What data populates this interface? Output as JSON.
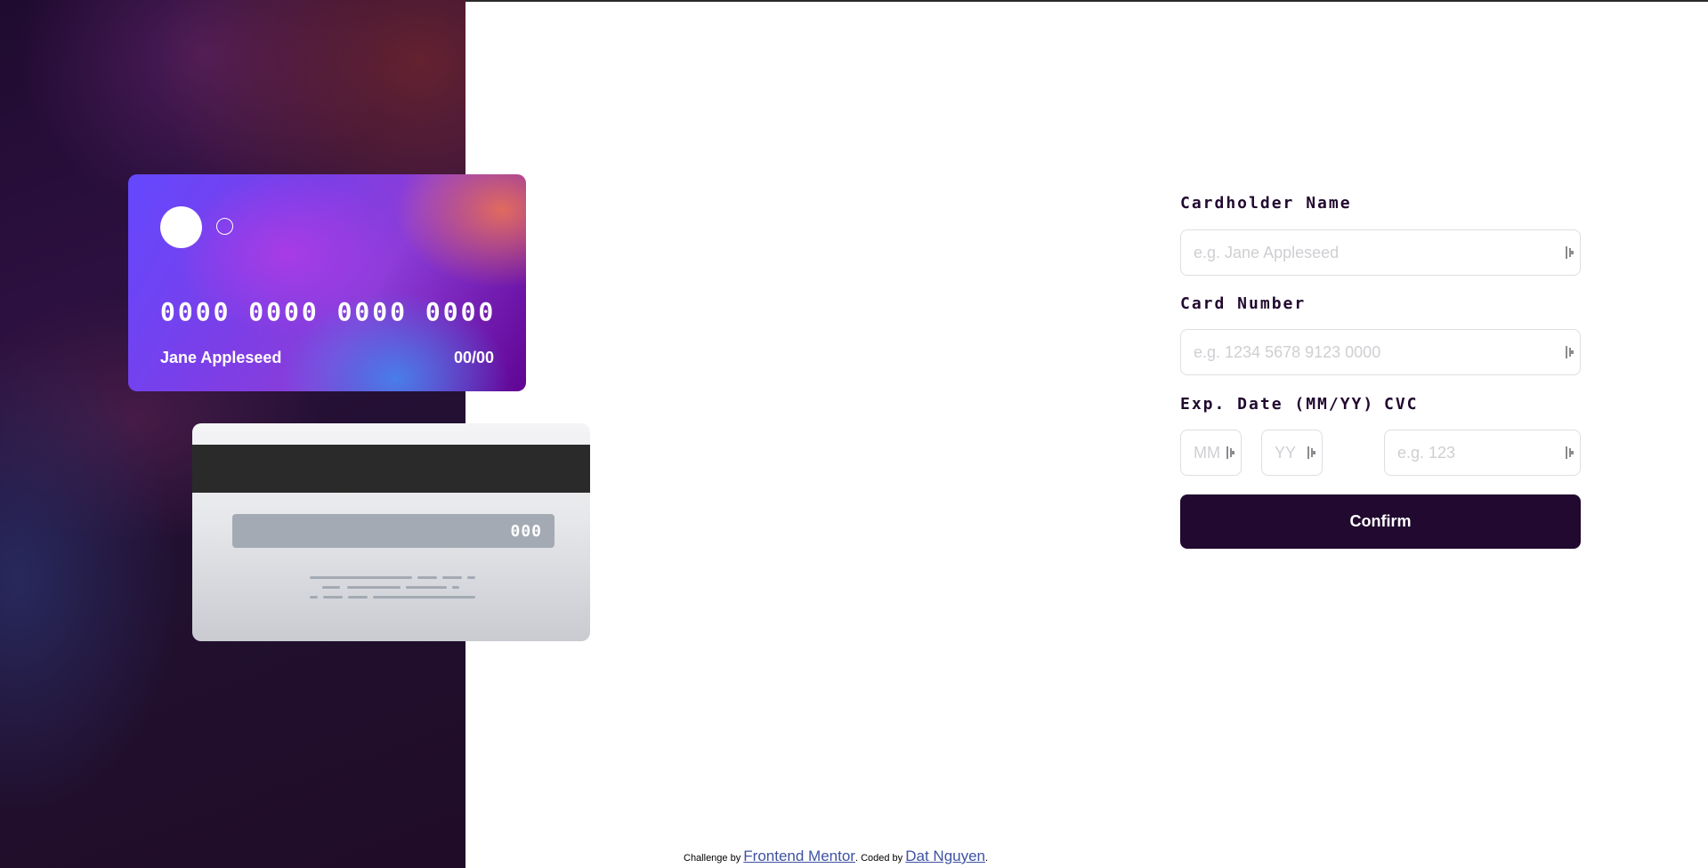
{
  "card_front": {
    "number": "0000 0000 0000 0000",
    "name": "Jane Appleseed",
    "expiry": "00/00"
  },
  "card_back": {
    "cvc": "000"
  },
  "form": {
    "cardholder_label": "Cardholder Name",
    "cardholder_placeholder": "e.g. Jane Appleseed",
    "card_number_label": "Card Number",
    "card_number_placeholder": "e.g. 1234 5678 9123 0000",
    "exp_label": "Exp. Date (MM/YY)",
    "month_placeholder": "MM",
    "year_placeholder": "YY",
    "cvc_label": "CVC",
    "cvc_placeholder": "e.g. 123",
    "confirm_label": "Confirm"
  },
  "footer": {
    "challenge_prefix": "Challenge by",
    "challenge_link": "Frontend Mentor",
    "coded_prefix": ". Coded by",
    "coded_link": "Dat Nguyen",
    "suffix": "."
  },
  "colors": {
    "primary": "#21092f",
    "input_border": "#dfdee0",
    "placeholder": "#cfcfd3",
    "link": "#3e52a3"
  }
}
